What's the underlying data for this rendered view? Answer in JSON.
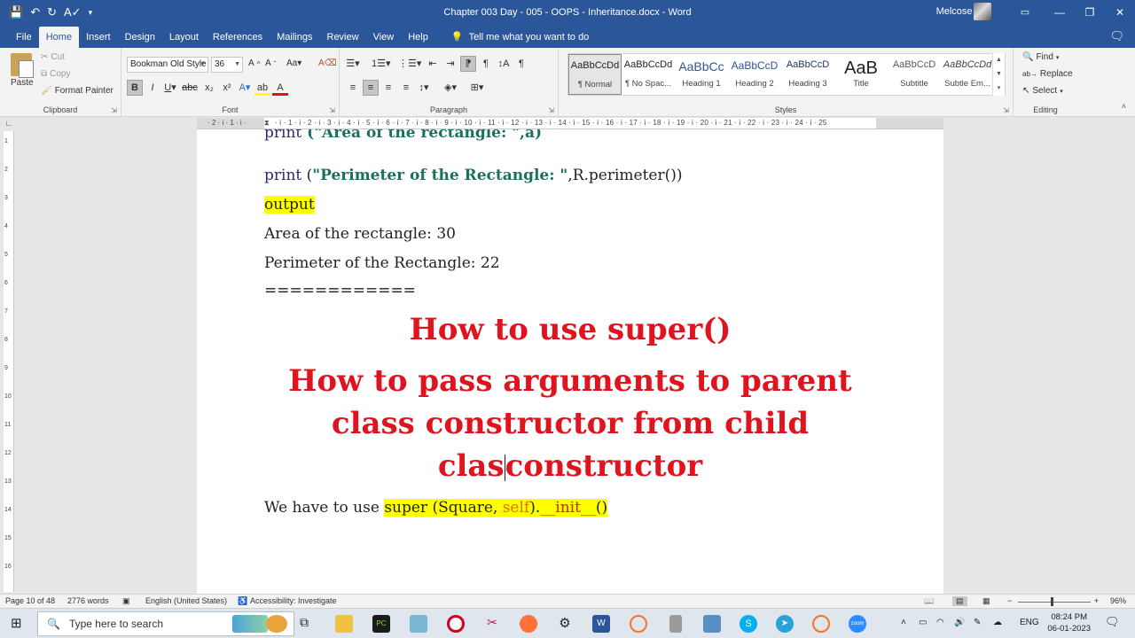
{
  "titlebar": {
    "title": "Chapter 003 Day - 005 - OOPS - Inheritance.docx  -  Word",
    "user": "Melcose .A",
    "minimize": "—",
    "restore": "❐",
    "close": "✕",
    "ribbon_options": "▭"
  },
  "tabs": [
    "File",
    "Home",
    "Insert",
    "Design",
    "Layout",
    "References",
    "Mailings",
    "Review",
    "View",
    "Help"
  ],
  "tell_me": "Tell me what you want to do",
  "clipboard": {
    "paste": "Paste",
    "cut": "Cut",
    "copy": "Copy",
    "format_painter": "Format Painter",
    "label": "Clipboard"
  },
  "font": {
    "name": "Bookman Old Style",
    "size": "36",
    "label": "Font"
  },
  "paragraph": {
    "label": "Paragraph"
  },
  "styles": {
    "label": "Styles",
    "items": [
      {
        "preview": "AaBbCcDd",
        "name": "¶ Normal"
      },
      {
        "preview": "AaBbCcDd",
        "name": "¶ No Spac..."
      },
      {
        "preview": "AaBbCc",
        "name": "Heading 1"
      },
      {
        "preview": "AaBbCcD",
        "name": "Heading 2"
      },
      {
        "preview": "AaBbCcD",
        "name": "Heading 3"
      },
      {
        "preview": "AaB",
        "name": "Title"
      },
      {
        "preview": "AaBbCcD",
        "name": "Subtitle"
      },
      {
        "preview": "AaBbCcDd",
        "name": "Subtle Em..."
      }
    ]
  },
  "editing": {
    "find": "Find",
    "replace": "Replace",
    "select": "Select",
    "label": "Editing"
  },
  "document": {
    "line0_kw": "print",
    "line0_rest": " (\"Area of the rectangle: \",a)",
    "line1_kw": "print",
    "line1_open": " (",
    "line1_str": "\"Perimeter of the Rectangle: \"",
    "line1_rest": ",R.perimeter())",
    "output_label": "output",
    "area_line": "Area of the rectangle: 30",
    "perimeter_line": "Perimeter of the Rectangle:  22",
    "separator": "============",
    "heading1": "How to use super()",
    "heading2_line1": "How to pass arguments to parent",
    "heading2_line2": "class constructor from child",
    "heading2_line3_a": "clas",
    "heading2_line3_b": "constructor",
    "body_plain": "We have to use ",
    "body_hl_a": "super (Square, ",
    "body_hl_self": "self",
    "body_hl_b": ").",
    "body_hl_init": "__init__",
    "body_hl_c": "()"
  },
  "statusbar": {
    "page": "Page 10 of 48",
    "words": "2776 words",
    "language": "English (United States)",
    "accessibility": "Accessibility: Investigate",
    "zoom": "96%"
  },
  "taskbar": {
    "search_placeholder": "Type here to search",
    "lang": "ENG",
    "time": "08:24 PM",
    "date": "06-01-2023"
  },
  "colors": {
    "ribbon_blue": "#2b579a",
    "heading_red": "#e0141e",
    "string_teal": "#1a7060",
    "highlight": "#ffff00",
    "self_orange": "#e86a10"
  }
}
